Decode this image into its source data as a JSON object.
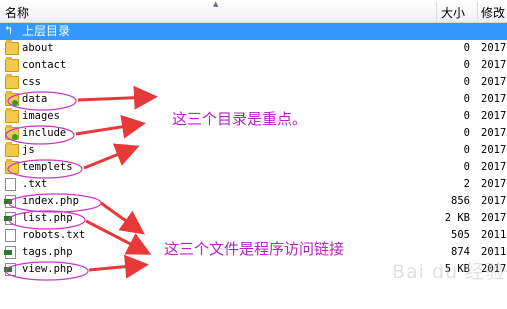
{
  "header": {
    "name": "名称",
    "size": "大小",
    "modified": "修改"
  },
  "rows": [
    {
      "name": "上层目录",
      "size": "",
      "date": "",
      "type": "up"
    },
    {
      "name": "about",
      "size": "0",
      "date": "2017",
      "type": "folder"
    },
    {
      "name": "contact",
      "size": "0",
      "date": "2017",
      "type": "folder"
    },
    {
      "name": "css",
      "size": "0",
      "date": "2017",
      "type": "folder"
    },
    {
      "name": "data",
      "size": "0",
      "date": "2017",
      "type": "folder-green"
    },
    {
      "name": "images",
      "size": "0",
      "date": "2017",
      "type": "folder"
    },
    {
      "name": "include",
      "size": "0",
      "date": "2017",
      "type": "folder-green"
    },
    {
      "name": "js",
      "size": "0",
      "date": "2017",
      "type": "folder"
    },
    {
      "name": "templets",
      "size": "0",
      "date": "2017",
      "type": "folder"
    },
    {
      "name": ".txt",
      "size": "2",
      "date": "2017",
      "type": "file"
    },
    {
      "name": "index.php",
      "size": "856",
      "date": "2017",
      "type": "php"
    },
    {
      "name": "list.php",
      "size": "2 KB",
      "date": "2017",
      "type": "php"
    },
    {
      "name": "robots.txt",
      "size": "505",
      "date": "2011",
      "type": "file"
    },
    {
      "name": "tags.php",
      "size": "874",
      "date": "2011",
      "type": "php"
    },
    {
      "name": "view.php",
      "size": "5 KB",
      "date": "2017",
      "type": "php"
    }
  ],
  "annotations": {
    "note_dirs": "这三个目录是重点。",
    "note_files": "这三个文件是程序访问链接"
  },
  "watermark": "Bai du 经验",
  "colors": {
    "selected": "#3399ff",
    "annotation": "#b424c4",
    "arrow": "#e8393a"
  }
}
